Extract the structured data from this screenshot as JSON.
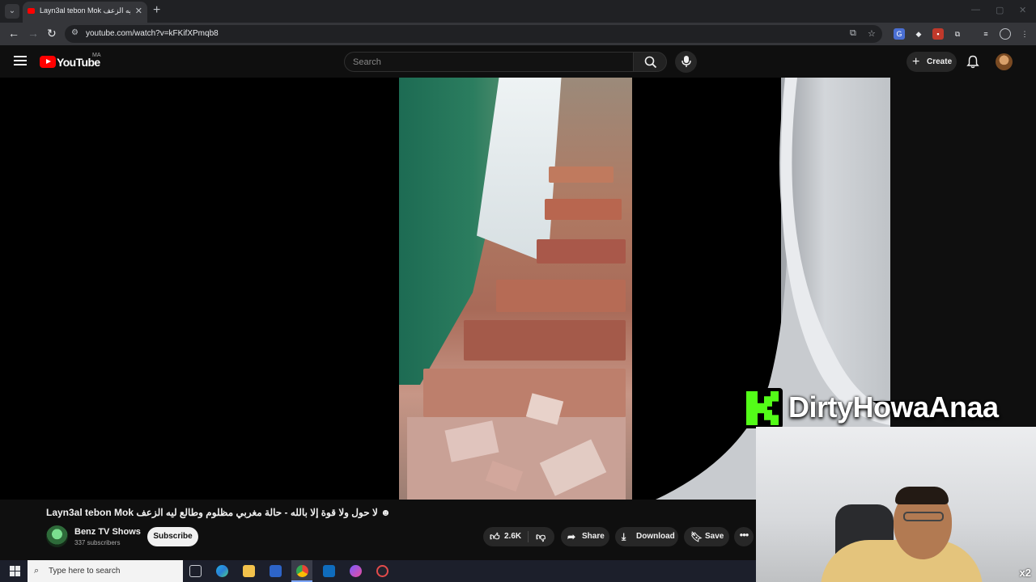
{
  "browser": {
    "tab_title": "Layn3al tebon Mok لا حول ولا قوة إلا بالله - حالة مغربي مظلوم وطالع ليه الزعف",
    "tab_close": "✕",
    "new_tab": "+",
    "url": "youtube.com/watch?v=kFKifXPmqb8",
    "back": "←",
    "forward": "→",
    "reload": "↻"
  },
  "header": {
    "logo_text": "YouTube",
    "country_code": "MA",
    "search_placeholder": "Search",
    "create_label": "Create",
    "create_plus": "+"
  },
  "video": {
    "title": "Layn3al tebon Mok لا حول ولا قوة إلا بالله - حالة مغربي مظلوم وطالع ليه الزعف ☻"
  },
  "stream_overlay": {
    "streamer_name": "DirtyHowaAnaa",
    "badge": "x2",
    "accent": "#53fc18"
  },
  "channel": {
    "name": "Benz TV Shows",
    "subscribers": "337 subscribers",
    "subscribe_label": "Subscribe"
  },
  "actions": {
    "like_count": "2.6K",
    "share_label": "Share",
    "download_label": "Download",
    "save_label": "Save",
    "more_label": "•••"
  },
  "taskbar": {
    "search_placeholder": "Type here to search"
  },
  "colors": {
    "youtube_red": "#ff0000",
    "background": "#0f0f0f",
    "pill": "#272727"
  }
}
